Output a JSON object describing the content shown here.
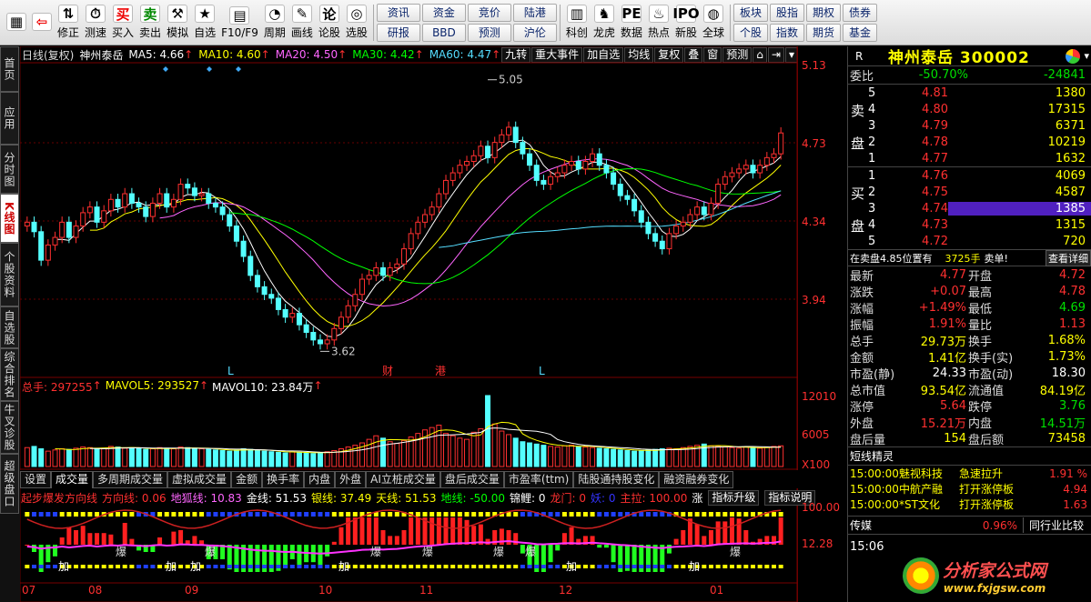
{
  "toolbar": {
    "left": [
      {
        "l": "",
        "ic": "▦",
        "n": "app-logo"
      },
      {
        "l": "",
        "ic": "⇦",
        "n": "back-arrow-icon"
      },
      {
        "l": "修正",
        "ic": "⇅",
        "n": "adjust-icon"
      },
      {
        "l": "测速",
        "ic": "⏱",
        "n": "speed-test-icon"
      },
      {
        "l": "买入",
        "ic": "买",
        "n": "buy-icon"
      },
      {
        "l": "卖出",
        "ic": "卖",
        "n": "sell-icon"
      },
      {
        "l": "模拟",
        "ic": "⚒",
        "n": "simulate-icon"
      },
      {
        "l": "自选",
        "ic": "★",
        "n": "watchlist-icon"
      },
      {
        "l": "F10/F9",
        "ic": "▤",
        "n": "f10-icon"
      },
      {
        "l": "周期",
        "ic": "◔",
        "n": "period-icon"
      },
      {
        "l": "画线",
        "ic": "✎",
        "n": "draw-line-icon"
      },
      {
        "l": "论股",
        "ic": "论",
        "n": "discuss-icon"
      },
      {
        "l": "选股",
        "ic": "◎",
        "n": "stock-picker-icon"
      }
    ],
    "nav1": [
      "资讯",
      "资金",
      "竞价",
      "陆港",
      "研报",
      "BBD",
      "预测",
      "沪伦"
    ],
    "mid": [
      {
        "l": "科创",
        "ic": "▥",
        "n": "star-market-icon"
      },
      {
        "l": "龙虎",
        "ic": "♞",
        "n": "dragon-tiger-icon"
      },
      {
        "l": "数据",
        "ic": "PE",
        "n": "data-icon"
      },
      {
        "l": "热点",
        "ic": "♨",
        "n": "hotspot-icon"
      },
      {
        "l": "新股",
        "ic": "IPO",
        "n": "ipo-icon"
      },
      {
        "l": "全球",
        "ic": "◍",
        "n": "globe-icon"
      }
    ],
    "nav2": [
      "板块",
      "股指",
      "期权",
      "债券",
      "个股",
      "指数",
      "期货",
      "基金"
    ]
  },
  "lefttabs": [
    "首页",
    "应用",
    "分时图",
    "K线图",
    "个股资料",
    "自选股",
    "综合排名",
    "牛叉诊股",
    "超级盘口"
  ],
  "main": {
    "header_left": "日线(复权)",
    "stock": "神州泰岳",
    "ma": [
      {
        "k": "MA5: 4.66",
        "c": "#ffffff"
      },
      {
        "k": "MA10: 4.60",
        "c": "#ffff00"
      },
      {
        "k": "MA20: 4.50",
        "c": "#ff66ff"
      },
      {
        "k": "MA30: 4.42",
        "c": "#00ff00"
      },
      {
        "k": "MA60: 4.47",
        "c": "#55ddff"
      }
    ],
    "buttons": [
      "九转",
      "重大事件",
      "加自选",
      "均线",
      "复权",
      "叠",
      "窗",
      "预测"
    ],
    "high_label": "5.05",
    "low_label": "3.62",
    "markers": [
      "L",
      "财",
      "港",
      "L"
    ]
  },
  "volume": {
    "total": "总手: 297255",
    "mavol5": "MAVOL5: 293527",
    "mavol10": "MAVOL10: 23.84万",
    "ticks": [
      "12010",
      "6005",
      "X100"
    ]
  },
  "price_ticks": [
    "5.13",
    "4.73",
    "4.34",
    "3.94"
  ],
  "bottom_tabs": [
    "设置",
    "成交量",
    "多周期成交量",
    "虚拟成交量",
    "金额",
    "换手率",
    "内盘",
    "外盘",
    "AI立桩成交量",
    "盘后成交量",
    "市盈率(ttm)",
    "陆股通持股变化",
    "融资融券变化"
  ],
  "indicator": {
    "title": "起步爆发方向线",
    "items": [
      {
        "k": "方向线: 0.06",
        "c": "#ff3030"
      },
      {
        "k": "地狐线: 10.83",
        "c": "#ff66ff"
      },
      {
        "k": "金线: 51.53",
        "c": "#ffffff"
      },
      {
        "k": "银线: 37.49",
        "c": "#ffff00"
      },
      {
        "k": "天线: 51.53",
        "c": "#ffff00"
      },
      {
        "k": "地线: -50.00",
        "c": "#00ff00"
      },
      {
        "k": "锦鲤: 0",
        "c": "#ffffff"
      },
      {
        "k": "龙门: 0",
        "c": "#ff3030"
      },
      {
        "k": "妖: 0",
        "c": "#3333ff"
      },
      {
        "k": "主拉: 100.00",
        "c": "#ff3030"
      },
      {
        "k": "涨",
        "c": "#ffffff"
      }
    ],
    "btn1": "指标升级",
    "btn2": "指标说明",
    "ticks": [
      "100.00",
      "12.28"
    ],
    "marks": [
      "加",
      "加",
      "加",
      "加",
      "加",
      "加",
      "爆",
      "爆",
      "爆",
      "爆",
      "爆",
      "爆",
      "爆"
    ]
  },
  "xaxis": [
    "07",
    "08",
    "09",
    "10",
    "11",
    "12",
    "01"
  ],
  "quote": {
    "name": "神州泰岳 300002",
    "webi": "委比",
    "webi_v": "-50.70%",
    "webi_d": "-24841",
    "sell_label": [
      "卖",
      "盘"
    ],
    "buy_label": [
      "买",
      "盘"
    ],
    "sells": [
      [
        "5",
        "4.81",
        "1380"
      ],
      [
        "4",
        "4.80",
        "17315"
      ],
      [
        "3",
        "4.79",
        "6371"
      ],
      [
        "2",
        "4.78",
        "10219"
      ],
      [
        "1",
        "4.77",
        "1632"
      ]
    ],
    "buys": [
      [
        "1",
        "4.76",
        "4069"
      ],
      [
        "2",
        "4.75",
        "4587"
      ],
      [
        "3",
        "4.74",
        "1385"
      ],
      [
        "4",
        "4.73",
        "1315"
      ],
      [
        "5",
        "4.72",
        "720"
      ]
    ],
    "info_line": "在卖盘4.85位置有",
    "info_qty": "3725手",
    "info_sell": "卖单!",
    "info_detail": "查看详细",
    "stats": [
      [
        "最新",
        "4.77",
        "red",
        "开盘",
        "4.72",
        "red"
      ],
      [
        "涨跌",
        "+0.07",
        "red",
        "最高",
        "4.78",
        "red"
      ],
      [
        "涨幅",
        "+1.49%",
        "red",
        "最低",
        "4.69",
        "grn"
      ],
      [
        "振幅",
        "1.91%",
        "red",
        "量比",
        "1.13",
        "red"
      ],
      [
        "总手",
        "29.73万",
        "yel",
        "换手",
        "1.68%",
        "yel"
      ],
      [
        "金额",
        "1.41亿",
        "yel",
        "换手(实)",
        "1.73%",
        "yel"
      ],
      [
        "市盈(静)",
        "24.33",
        "wht",
        "市盈(动)",
        "18.30",
        "wht"
      ],
      [
        "总市值",
        "93.54亿",
        "yel",
        "流通值",
        "84.19亿",
        "yel"
      ],
      [
        "涨停",
        "5.64",
        "red",
        "跌停",
        "3.76",
        "grn"
      ],
      [
        "外盘",
        "15.21万",
        "red",
        "内盘",
        "14.51万",
        "grn"
      ],
      [
        "盘后量",
        "154",
        "yel",
        "盘后额",
        "73458",
        "yel"
      ]
    ],
    "short_title": "短线精灵",
    "short": [
      [
        "15:00:00",
        "魅视科技",
        "急速拉升",
        "1.91 %"
      ],
      [
        "15:00:00",
        "中航产融",
        "打开涨停板",
        "4.94"
      ],
      [
        "15:00:00",
        "*ST文化",
        "打开涨停板",
        "1.63"
      ]
    ],
    "sector": "传媒",
    "sector_v": "0.96%",
    "peer": "同行业比较",
    "time": "15:06",
    "watermark": "分析家公式网",
    "watermark_url": "www.fxjgsw.com"
  },
  "chart_data": {
    "type": "candlestick",
    "ylim": [
      3.55,
      5.13
    ],
    "open": [
      4.28,
      4.3,
      4.25,
      4.1,
      4.18,
      4.22,
      4.3,
      4.22,
      4.28,
      4.35,
      4.38,
      4.3,
      4.36,
      4.42,
      4.38,
      4.45,
      4.4,
      4.38,
      4.33,
      4.4,
      4.45,
      4.38,
      4.42,
      4.5,
      4.48,
      4.44,
      4.45,
      4.4,
      4.38,
      4.34,
      4.28,
      4.2,
      4.12,
      4.02,
      3.96,
      3.92,
      3.9,
      3.84,
      3.8,
      3.82,
      3.76,
      3.72,
      3.68,
      3.66,
      3.68,
      3.74,
      3.8,
      3.86,
      3.92,
      4.0,
      4.02,
      4.06,
      4.02,
      4.06,
      4.08,
      4.16,
      4.24,
      4.3,
      4.34,
      4.38,
      4.45,
      4.52,
      4.56,
      4.6,
      4.62,
      4.65,
      4.7,
      4.64,
      4.72,
      4.76,
      4.8,
      4.72,
      4.66,
      4.6,
      4.52,
      4.5,
      4.54,
      4.56,
      4.6,
      4.62,
      4.58,
      4.62,
      4.66,
      4.6,
      4.56,
      4.5,
      4.44,
      4.42,
      4.36,
      4.3,
      4.24,
      4.2,
      4.16,
      4.24,
      4.28,
      4.3,
      4.34,
      4.38,
      4.34,
      4.4,
      4.5,
      4.54,
      4.56,
      4.58,
      4.6,
      4.56,
      4.6,
      4.64,
      4.66
    ],
    "close": [
      4.3,
      4.25,
      4.1,
      4.18,
      4.22,
      4.3,
      4.22,
      4.28,
      4.35,
      4.38,
      4.3,
      4.36,
      4.42,
      4.38,
      4.45,
      4.4,
      4.38,
      4.33,
      4.4,
      4.45,
      4.38,
      4.42,
      4.5,
      4.48,
      4.44,
      4.45,
      4.4,
      4.38,
      4.34,
      4.28,
      4.2,
      4.12,
      4.02,
      3.96,
      3.92,
      3.9,
      3.84,
      3.8,
      3.82,
      3.76,
      3.72,
      3.68,
      3.66,
      3.68,
      3.74,
      3.8,
      3.86,
      3.92,
      4.0,
      4.02,
      4.06,
      4.02,
      4.06,
      4.08,
      4.16,
      4.24,
      4.3,
      4.34,
      4.38,
      4.45,
      4.52,
      4.56,
      4.6,
      4.62,
      4.65,
      4.7,
      4.64,
      4.72,
      4.76,
      4.8,
      4.72,
      4.66,
      4.6,
      4.52,
      4.5,
      4.54,
      4.56,
      4.6,
      4.62,
      4.58,
      4.62,
      4.66,
      4.6,
      4.56,
      4.5,
      4.44,
      4.42,
      4.36,
      4.3,
      4.24,
      4.2,
      4.16,
      4.24,
      4.28,
      4.3,
      4.34,
      4.38,
      4.34,
      4.4,
      4.5,
      4.54,
      4.56,
      4.58,
      4.6,
      4.56,
      4.6,
      4.64,
      4.66,
      4.77
    ],
    "volume": [
      3200,
      3400,
      3000,
      2600,
      2800,
      3000,
      2900,
      3100,
      3300,
      3200,
      3000,
      3100,
      3400,
      3300,
      3100,
      3200,
      3000,
      2900,
      3000,
      3200,
      3100,
      3000,
      3300,
      3200,
      3100,
      3000,
      2900,
      2800,
      2700,
      2600,
      2800,
      3000,
      2900,
      2700,
      2600,
      2500,
      2400,
      2300,
      2500,
      2400,
      2300,
      2200,
      2300,
      2500,
      2700,
      3000,
      3300,
      3600,
      4000,
      4600,
      5200,
      4800,
      4200,
      3900,
      4400,
      5000,
      5600,
      6200,
      6600,
      7000,
      5600,
      5200,
      4800,
      4600,
      5800,
      6400,
      12010,
      7200,
      6000,
      5400,
      4800,
      4200,
      4000,
      3800,
      3600,
      3400,
      3300,
      3500,
      3600,
      3400,
      3300,
      3200,
      3100,
      3000,
      2900,
      2800,
      2700,
      2600,
      2700,
      2800,
      2900,
      3000,
      3100,
      3000,
      3200,
      3400,
      3600,
      3800,
      3500,
      3400,
      3300,
      3200,
      3100,
      3300,
      3200,
      3100,
      3300,
      3400,
      3500
    ]
  }
}
